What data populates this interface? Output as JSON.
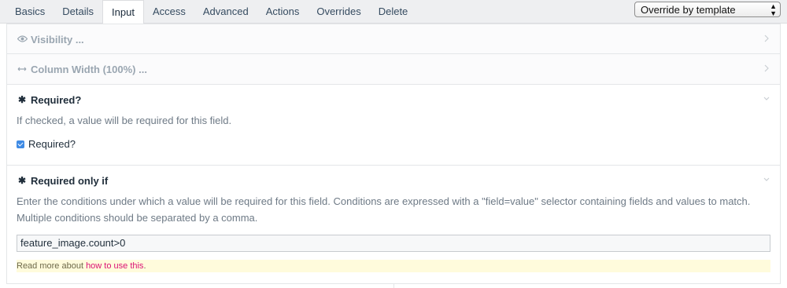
{
  "tabs": [
    {
      "label": "Basics",
      "active": false
    },
    {
      "label": "Details",
      "active": false
    },
    {
      "label": "Input",
      "active": true
    },
    {
      "label": "Access",
      "active": false
    },
    {
      "label": "Advanced",
      "active": false
    },
    {
      "label": "Actions",
      "active": false
    },
    {
      "label": "Overrides",
      "active": false
    },
    {
      "label": "Delete",
      "active": false
    }
  ],
  "template_select": {
    "value": "Override by template"
  },
  "visibility": {
    "icon": "eye-icon",
    "title": "Visibility ..."
  },
  "column_width": {
    "icon": "arrows-horizontal-icon",
    "title": "Column Width (100%) ..."
  },
  "required": {
    "icon": "asterisk-icon",
    "title": "Required?",
    "description": "If checked, a value will be required for this field.",
    "checkbox_label": "Required?",
    "checked": true
  },
  "required_if": {
    "icon": "asterisk-icon",
    "title": "Required only if",
    "description": "Enter the conditions under which a value will be required for this field. Conditions are expressed with a \"field=value\" selector containing fields and values to match. Multiple conditions should be separated by a comma.",
    "input_value": "feature_image.count>0",
    "note_prefix": "Read more about ",
    "note_link": "how to use this",
    "note_suffix": "."
  },
  "colors": {
    "accent": "#db1174",
    "checkbox": "#3f8be5",
    "note_bg": "#fffbdc"
  }
}
